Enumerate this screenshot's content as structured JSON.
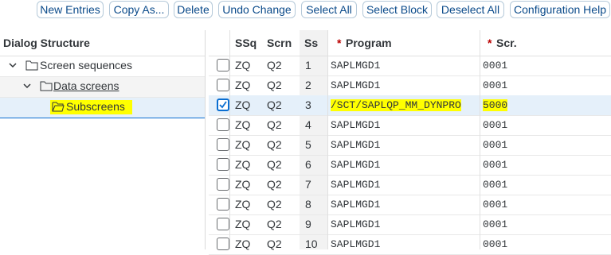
{
  "toolbar": {
    "new_entries": "New Entries",
    "copy_as": "Copy As...",
    "delete": "Delete",
    "undo_change": "Undo Change",
    "select_all": "Select All",
    "select_block": "Select Block",
    "deselect_all": "Deselect All",
    "configuration_help": "Configuration Help"
  },
  "dialog_structure": {
    "title": "Dialog Structure",
    "items": [
      {
        "label": "Screen sequences"
      },
      {
        "label": "Data screens"
      },
      {
        "label": "Subscreens"
      }
    ]
  },
  "table": {
    "columns": {
      "ssq": "SSq",
      "scrn": "Scrn",
      "ss": "Ss",
      "program_marker": "*",
      "program": "Program",
      "scr_marker": "*",
      "scr": "Scr."
    },
    "rows": [
      {
        "ssq": "ZQ",
        "scrn": "Q2",
        "ss": "1",
        "program": "SAPLMGD1",
        "scr": "0001",
        "checked": false
      },
      {
        "ssq": "ZQ",
        "scrn": "Q2",
        "ss": "2",
        "program": "SAPLMGD1",
        "scr": "0001",
        "checked": false
      },
      {
        "ssq": "ZQ",
        "scrn": "Q2",
        "ss": "3",
        "program": "/SCT/SAPLQP_MM_DYNPRO",
        "scr": "5000",
        "checked": true
      },
      {
        "ssq": "ZQ",
        "scrn": "Q2",
        "ss": "4",
        "program": "SAPLMGD1",
        "scr": "0001",
        "checked": false
      },
      {
        "ssq": "ZQ",
        "scrn": "Q2",
        "ss": "5",
        "program": "SAPLMGD1",
        "scr": "0001",
        "checked": false
      },
      {
        "ssq": "ZQ",
        "scrn": "Q2",
        "ss": "6",
        "program": "SAPLMGD1",
        "scr": "0001",
        "checked": false
      },
      {
        "ssq": "ZQ",
        "scrn": "Q2",
        "ss": "7",
        "program": "SAPLMGD1",
        "scr": "0001",
        "checked": false
      },
      {
        "ssq": "ZQ",
        "scrn": "Q2",
        "ss": "8",
        "program": "SAPLMGD1",
        "scr": "0001",
        "checked": false
      },
      {
        "ssq": "ZQ",
        "scrn": "Q2",
        "ss": "9",
        "program": "SAPLMGD1",
        "scr": "0001",
        "checked": false
      },
      {
        "ssq": "ZQ",
        "scrn": "Q2",
        "ss": "10",
        "program": "SAPLMGD1",
        "scr": "0001",
        "checked": false
      }
    ]
  },
  "colors": {
    "accent": "#0a6ed1",
    "highlight": "#ffff00",
    "required": "#bb0000",
    "selected_row": "#e5f0fa"
  },
  "icons": [
    "chevron-down-icon",
    "folder-icon",
    "folder-open-icon",
    "checkbox-icon"
  ]
}
